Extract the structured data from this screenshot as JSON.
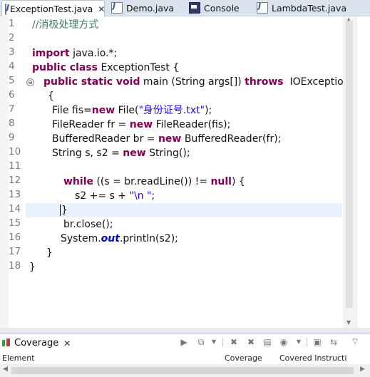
{
  "editor_tabs": [
    {
      "label": "ExceptionTest.java",
      "icon": "java-file-icon",
      "active": true,
      "close": "✕"
    },
    {
      "label": "Demo.java",
      "icon": "java-file-icon",
      "active": false
    },
    {
      "label": "Console",
      "icon": "console-icon",
      "active": false
    },
    {
      "label": "LambdaTest.java",
      "icon": "java-file-icon",
      "active": false
    }
  ],
  "code": {
    "line_numbers": [
      "1",
      "2",
      "3",
      "4",
      "5",
      "6",
      "7",
      "8",
      "9",
      "10",
      "11",
      "12",
      "13",
      "14",
      "15",
      "16",
      "17",
      "18"
    ],
    "fold_marker": "⊖",
    "current_line": 14
  },
  "coverage_view": {
    "tab_label": "Coverage",
    "close": "✕",
    "columns": [
      "Element",
      "Coverage",
      "Covered Instructi"
    ]
  },
  "colors": {
    "keyword": "#7f0055",
    "comment": "#3f7f5f",
    "string": "#2a00ff",
    "static_field": "#0000c0",
    "current_line_bg": "#e8f2fe"
  }
}
